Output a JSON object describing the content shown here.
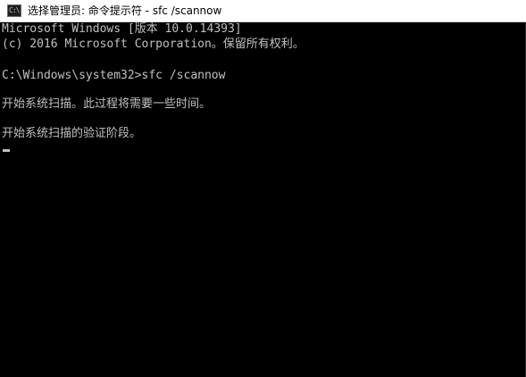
{
  "window": {
    "title": "选择管理员: 命令提示符 - sfc  /scannow",
    "icon": "command-prompt-icon",
    "icon_glyph": "C:\\"
  },
  "console": {
    "lines": [
      "Microsoft Windows [版本 10.0.14393]",
      "(c) 2016 Microsoft Corporation。保留所有权利。",
      "",
      "C:\\Windows\\system32>sfc /scannow",
      "",
      "开始系统扫描。此过程将需要一些时间。",
      "",
      "开始系统扫描的验证阶段。"
    ],
    "text_color": "#c0c0c0",
    "background_color": "#000000"
  }
}
